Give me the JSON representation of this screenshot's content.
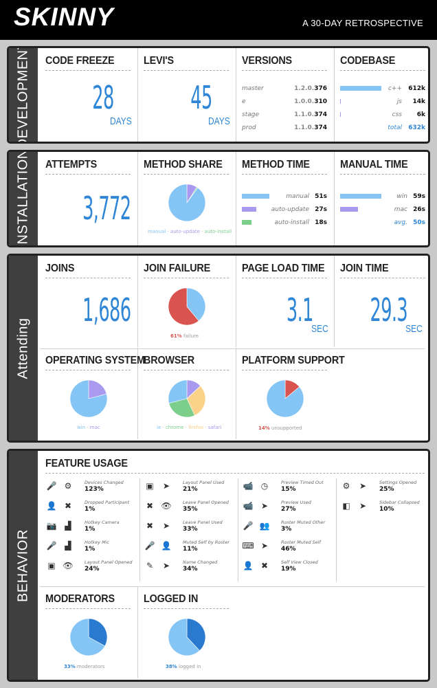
{
  "header": {
    "logo": "SKINNY",
    "tagline": "A 30-DAY RETROSPECTIVE"
  },
  "development": {
    "label": "DEVELOPMENT",
    "code_freeze": {
      "title": "CODE FREEZE",
      "value": "28",
      "unit": "DAYS"
    },
    "levis": {
      "title": "LEVI'S",
      "value": "45",
      "unit": "DAYS"
    },
    "versions": {
      "title": "VERSIONS",
      "rows": [
        {
          "name": "master",
          "prefix": "1.2.0.",
          "num": "376"
        },
        {
          "name": "e",
          "prefix": "1.0.0.",
          "num": "310"
        },
        {
          "name": "stage",
          "prefix": "1.1.0.",
          "num": "374"
        },
        {
          "name": "prod",
          "prefix": "1.1.0.",
          "num": "374"
        }
      ]
    },
    "codebase": {
      "title": "CODEBASE",
      "rows": [
        {
          "name": "c++",
          "value": "612k"
        },
        {
          "name": "js",
          "value": "14k"
        },
        {
          "name": "css",
          "value": "6k"
        },
        {
          "name": "total",
          "value": "632k"
        }
      ]
    }
  },
  "installation": {
    "label": "INSTALLATION",
    "attempts": {
      "title": "ATTEMPTS",
      "value": "3,772"
    },
    "method_share": {
      "title": "METHOD SHARE",
      "legend": [
        "manual",
        "auto-update",
        "auto-install"
      ]
    },
    "method_time": {
      "title": "METHOD TIME",
      "rows": [
        {
          "name": "manual",
          "value": "51s"
        },
        {
          "name": "auto-update",
          "value": "27s"
        },
        {
          "name": "auto-install",
          "value": "18s"
        }
      ]
    },
    "manual_time": {
      "title": "MANUAL TIME",
      "rows": [
        {
          "name": "win",
          "value": "59s"
        },
        {
          "name": "mac",
          "value": "26s"
        },
        {
          "name": "avg.",
          "value": "50s"
        }
      ]
    }
  },
  "attending": {
    "label": "Attending",
    "joins": {
      "title": "JOINS",
      "value": "1,686"
    },
    "join_failure": {
      "title": "JOIN FAILURE",
      "pct": "61%",
      "caption": "failure"
    },
    "page_load": {
      "title": "PAGE LOAD TIME",
      "value": "3.1",
      "unit": "SEC"
    },
    "join_time": {
      "title": "JOIN TIME",
      "value": "29.3",
      "unit": "SEC"
    },
    "os": {
      "title": "OPERATING SYSTEM",
      "legend": [
        "win",
        "mac"
      ]
    },
    "browser": {
      "title": "BROWSER",
      "legend": [
        "ie",
        "chrome",
        "firefox",
        "safari"
      ]
    },
    "platform": {
      "title": "PLATFORM SUPPORT",
      "pct": "14%",
      "caption": "unsupported"
    }
  },
  "behavior": {
    "label": "BEHAVIOR",
    "feature_title": "FEATURE USAGE",
    "features": [
      [
        {
          "name": "Devices Changed",
          "pct": "123%",
          "i1": "mic-camera-icon",
          "g1": "🎤",
          "i2": "gear-icon",
          "g2": "⚙"
        },
        {
          "name": "Dropped Participant",
          "pct": "1%",
          "i1": "user-icon",
          "g1": "👤",
          "i2": "close-icon",
          "g2": "✖"
        },
        {
          "name": "Hotkey Camera",
          "pct": "1%",
          "i1": "camera-off-icon",
          "g1": "📷",
          "i2": "keyboard-icon",
          "g2": "▟"
        },
        {
          "name": "Hotkey Mic",
          "pct": "1%",
          "i1": "mic-off-icon",
          "g1": "🎤",
          "i2": "keyboard-icon",
          "g2": "▟"
        },
        {
          "name": "Layout Panel Opened",
          "pct": "24%",
          "i1": "layout-icon",
          "g1": "▣",
          "i2": "eye-icon",
          "g2": "👁"
        }
      ],
      [
        {
          "name": "Layout Panel Used",
          "pct": "21%",
          "i1": "layout-icon",
          "g1": "▣",
          "i2": "cursor-icon",
          "g2": "➤"
        },
        {
          "name": "Leave Panel Opened",
          "pct": "35%",
          "i1": "close-icon",
          "g1": "✖",
          "i2": "eye-icon",
          "g2": "👁"
        },
        {
          "name": "Leave Panel Used",
          "pct": "33%",
          "i1": "close-icon",
          "g1": "✖",
          "i2": "cursor-icon",
          "g2": "➤"
        },
        {
          "name": "Muted Self by Roster",
          "pct": "11%",
          "i1": "mic-off-icon",
          "g1": "🎤",
          "i2": "user-icon",
          "g2": "👤"
        },
        {
          "name": "Name Changed",
          "pct": "34%",
          "i1": "pencil-icon",
          "g1": "✎",
          "i2": "cursor-icon",
          "g2": "➤"
        }
      ],
      [
        {
          "name": "Preview Timed Out",
          "pct": "15%",
          "i1": "video-question-icon",
          "g1": "📹",
          "i2": "clock-icon",
          "g2": "◷"
        },
        {
          "name": "Preview Used",
          "pct": "27%",
          "i1": "video-question-icon",
          "g1": "📹",
          "i2": "cursor-icon",
          "g2": "➤"
        },
        {
          "name": "Roster Muted Other",
          "pct": "3%",
          "i1": "mic-off-icon",
          "g1": "🎤",
          "i2": "group-icon",
          "g2": "👥"
        },
        {
          "name": "Roster Muted Self",
          "pct": "46%",
          "i1": "keyboard-icon",
          "g1": "⌨",
          "i2": "cursor-icon",
          "g2": "➤"
        },
        {
          "name": "Self View Closed",
          "pct": "19%",
          "i1": "user-video-icon",
          "g1": "👤",
          "i2": "close-icon",
          "g2": "✖"
        }
      ],
      [
        {
          "name": "Settings Opened",
          "pct": "25%",
          "i1": "gear-icon",
          "g1": "⚙",
          "i2": "cursor-icon",
          "g2": "➤"
        },
        {
          "name": "Sidebar Collapsed",
          "pct": "10%",
          "i1": "sidebar-icon",
          "g1": "◧",
          "i2": "cursor-icon",
          "g2": "➤"
        }
      ]
    ],
    "moderators": {
      "title": "MODERATORS",
      "pct": "33%",
      "caption": "moderators"
    },
    "logged_in": {
      "title": "LOGGED IN",
      "pct": "38%",
      "caption": "logged in"
    }
  },
  "colors": {
    "blue": "#2f86d6",
    "lightblue": "#85c5f5",
    "purple": "#a99af0",
    "green": "#7ccf8a",
    "red": "#d9534f",
    "orange": "#fcd28a",
    "darkblue": "#2a7ad0"
  },
  "chart_data": [
    {
      "type": "bar",
      "title": "CODEBASE",
      "categories": [
        "c++",
        "js",
        "css"
      ],
      "values": [
        612,
        14,
        6
      ],
      "total": 632,
      "unit": "k"
    },
    {
      "type": "pie",
      "title": "METHOD SHARE",
      "categories": [
        "manual",
        "auto-update",
        "auto-install"
      ],
      "values": [
        90,
        9,
        1
      ]
    },
    {
      "type": "bar",
      "title": "METHOD TIME",
      "categories": [
        "manual",
        "auto-update",
        "auto-install"
      ],
      "values": [
        51,
        27,
        18
      ],
      "unit": "s"
    },
    {
      "type": "bar",
      "title": "MANUAL TIME",
      "categories": [
        "win",
        "mac"
      ],
      "values": [
        59,
        26
      ],
      "avg": 50,
      "unit": "s"
    },
    {
      "type": "pie",
      "title": "JOIN FAILURE",
      "categories": [
        "failure",
        "success"
      ],
      "values": [
        61,
        39
      ]
    },
    {
      "type": "pie",
      "title": "OPERATING SYSTEM",
      "categories": [
        "win",
        "mac"
      ],
      "values": [
        79,
        21
      ]
    },
    {
      "type": "pie",
      "title": "BROWSER",
      "categories": [
        "ie",
        "chrome",
        "firefox",
        "safari"
      ],
      "values": [
        29,
        28,
        30,
        13
      ]
    },
    {
      "type": "pie",
      "title": "PLATFORM SUPPORT",
      "categories": [
        "unsupported",
        "supported"
      ],
      "values": [
        14,
        86
      ]
    },
    {
      "type": "pie",
      "title": "MODERATORS",
      "categories": [
        "moderators",
        "other"
      ],
      "values": [
        33,
        67
      ]
    },
    {
      "type": "pie",
      "title": "LOGGED IN",
      "categories": [
        "logged in",
        "other"
      ],
      "values": [
        38,
        62
      ]
    }
  ]
}
